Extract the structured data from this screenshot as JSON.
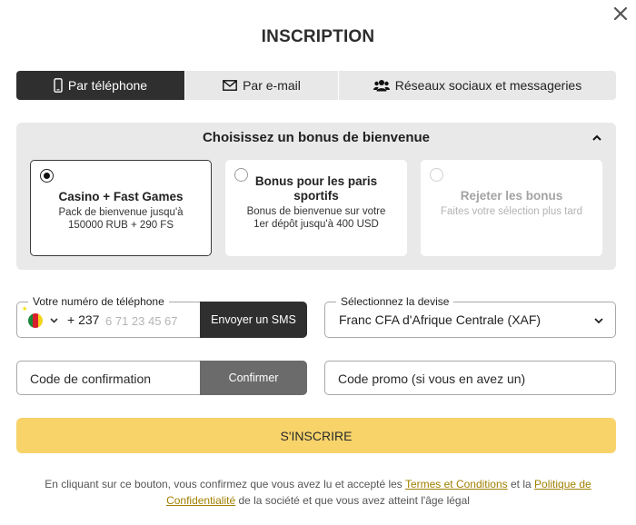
{
  "modal": {
    "title": "INSCRIPTION",
    "close_icon": "close-icon"
  },
  "tabs": [
    {
      "label": "Par téléphone",
      "icon": "smartphone-icon",
      "active": true
    },
    {
      "label": "Par e-mail",
      "icon": "envelope-icon",
      "active": false
    },
    {
      "label": "Réseaux sociaux et messageries",
      "icon": "users-icon",
      "active": false
    }
  ],
  "bonus": {
    "heading": "Choisissez un bonus de bienvenue",
    "toggle_icon": "chevron-up-icon",
    "options": [
      {
        "title": "Casino + Fast Games",
        "description": "Pack de bienvenue jusqu'à 150000 RUB + 290 FS",
        "selected": true
      },
      {
        "title": "Bonus pour les paris sportifs",
        "description": "Bonus de bienvenue sur votre 1er dépôt jusqu'à 400 USD",
        "selected": false
      },
      {
        "title": "Rejeter les bonus",
        "description": "Faites votre sélection plus tard",
        "selected": false
      }
    ]
  },
  "phone": {
    "legend": "Votre numéro de téléphone",
    "country_flag": "cameroon-flag-icon",
    "prefix": "+ 237",
    "placeholder": "6 71 23 45 67",
    "sms_button": "Envoyer un SMS"
  },
  "currency": {
    "legend": "Sélectionnez la devise",
    "value": "Franc CFA d'Afrique Centrale (XAF)"
  },
  "confirmation": {
    "placeholder": "Code de confirmation",
    "button": "Confirmer"
  },
  "promo": {
    "placeholder": "Code promo (si vous en avez un)"
  },
  "submit": {
    "label": "S'INSCRIRE"
  },
  "legal": {
    "text_before": "En cliquant sur ce bouton, vous confirmez que vous avez lu et accepté les ",
    "terms_link": "Termes et Conditions",
    "text_middle": " et la ",
    "privacy_link": "Politique de Confidentialité",
    "text_after": " de la société et que vous avez atteint l'âge légal"
  },
  "colors": {
    "accent_yellow": "#f7d36a",
    "dark_button": "#2f2f2f",
    "link_gold": "#a07f00",
    "panel_gray": "#e9e9e9"
  }
}
